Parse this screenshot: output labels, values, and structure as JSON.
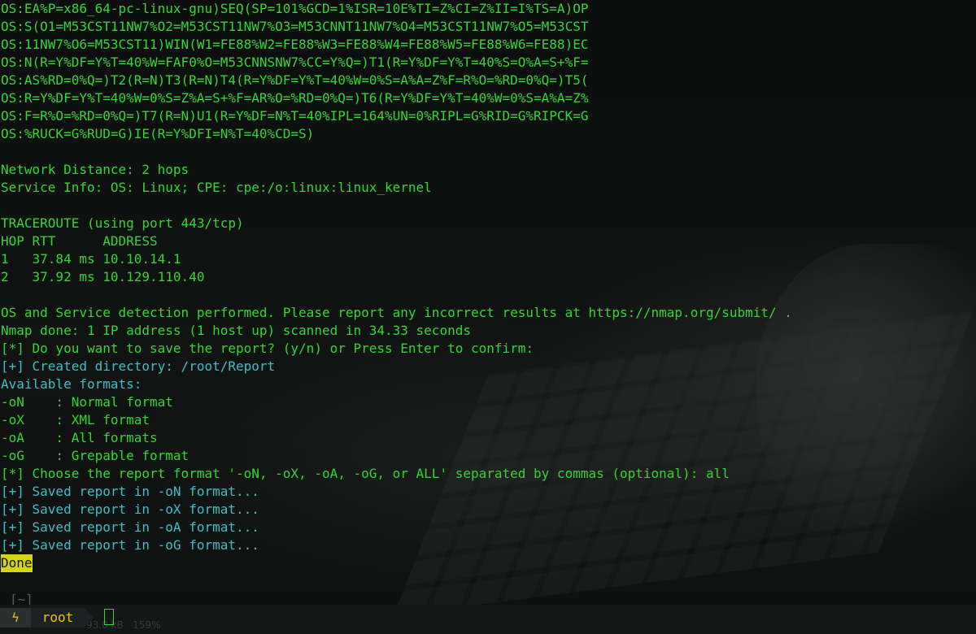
{
  "colors": {
    "terminal_green": "#33d633",
    "terminal_teal": "#3fbfc5",
    "highlight_yellow": "#d4d41c",
    "background": "#0d0f0f",
    "prompt_accent": "#e8c418"
  },
  "terminal": {
    "lines": [
      {
        "text": "OS:EA%P=x86_64-pc-linux-gnu)SEQ(SP=101%GCD=1%ISR=10E%TI=Z%CI=Z%II=I%TS=A)OP",
        "style": "green"
      },
      {
        "text": "OS:S(O1=M53CST11NW7%O2=M53CST11NW7%O3=M53CNNT11NW7%O4=M53CST11NW7%O5=M53CST",
        "style": "green"
      },
      {
        "text": "OS:11NW7%O6=M53CST11)WIN(W1=FE88%W2=FE88%W3=FE88%W4=FE88%W5=FE88%W6=FE88)EC",
        "style": "green"
      },
      {
        "text": "OS:N(R=Y%DF=Y%T=40%W=FAF0%O=M53CNNSNW7%CC=Y%Q=)T1(R=Y%DF=Y%T=40%S=O%A=S+%F=",
        "style": "green"
      },
      {
        "text": "OS:AS%RD=0%Q=)T2(R=N)T3(R=N)T4(R=Y%DF=Y%T=40%W=0%S=A%A=Z%F=R%O=%RD=0%Q=)T5(",
        "style": "green"
      },
      {
        "text": "OS:R=Y%DF=Y%T=40%W=0%S=Z%A=S+%F=AR%O=%RD=0%Q=)T6(R=Y%DF=Y%T=40%W=0%S=A%A=Z%",
        "style": "green"
      },
      {
        "text": "OS:F=R%O=%RD=0%Q=)T7(R=N)U1(R=Y%DF=N%T=40%IPL=164%UN=0%RIPL=G%RID=G%RIPCK=G",
        "style": "green"
      },
      {
        "text": "OS:%RUCK=G%RUD=G)IE(R=Y%DFI=N%T=40%CD=S)",
        "style": "green"
      },
      {
        "text": "",
        "style": "green"
      },
      {
        "text": "Network Distance: 2 hops",
        "style": "green"
      },
      {
        "text": "Service Info: OS: Linux; CPE: cpe:/o:linux:linux_kernel",
        "style": "green"
      },
      {
        "text": "",
        "style": "green"
      },
      {
        "text": "TRACEROUTE (using port 443/tcp)",
        "style": "green"
      },
      {
        "text": "HOP RTT      ADDRESS",
        "style": "green"
      },
      {
        "text": "1   37.84 ms 10.10.14.1",
        "style": "green"
      },
      {
        "text": "2   37.92 ms 10.129.110.40",
        "style": "green"
      },
      {
        "text": "",
        "style": "green"
      },
      {
        "text": "OS and Service detection performed. Please report any incorrect results at https://nmap.org/submit/ .",
        "style": "green"
      },
      {
        "text": "Nmap done: 1 IP address (1 host up) scanned in 34.33 seconds",
        "style": "green"
      },
      {
        "text": "[*] Do you want to save the report? (y/n) or Press Enter to confirm:",
        "style": "green"
      },
      {
        "text": "[+] Created directory: /root/Report",
        "style": "teal"
      },
      {
        "text": "Available formats:",
        "style": "teal"
      },
      {
        "text": "-oN    : Normal format",
        "style": "green"
      },
      {
        "text": "-oX    : XML format",
        "style": "green"
      },
      {
        "text": "-oA    : All formats",
        "style": "green"
      },
      {
        "text": "-oG    : Grepable format",
        "style": "green"
      },
      {
        "text": "[*] Choose the report format '-oN, -oX, -oA, -oG, or ALL' separated by commas (optional): all",
        "style": "green"
      },
      {
        "text": "[+] Saved report in -oN format...",
        "style": "teal"
      },
      {
        "text": "[+] Saved report in -oX format...",
        "style": "teal"
      },
      {
        "text": "[+] Saved report in -oA format...",
        "style": "teal"
      },
      {
        "text": "[+] Saved report in -oG format...",
        "style": "teal"
      }
    ],
    "done_label": "Done"
  },
  "prompt": {
    "directory": "[~]",
    "bolt_icon": "lightning-bolt-icon",
    "bolt_glyph": "ϟ",
    "user": "root",
    "ghost_text": "93.0 kB   159%"
  }
}
